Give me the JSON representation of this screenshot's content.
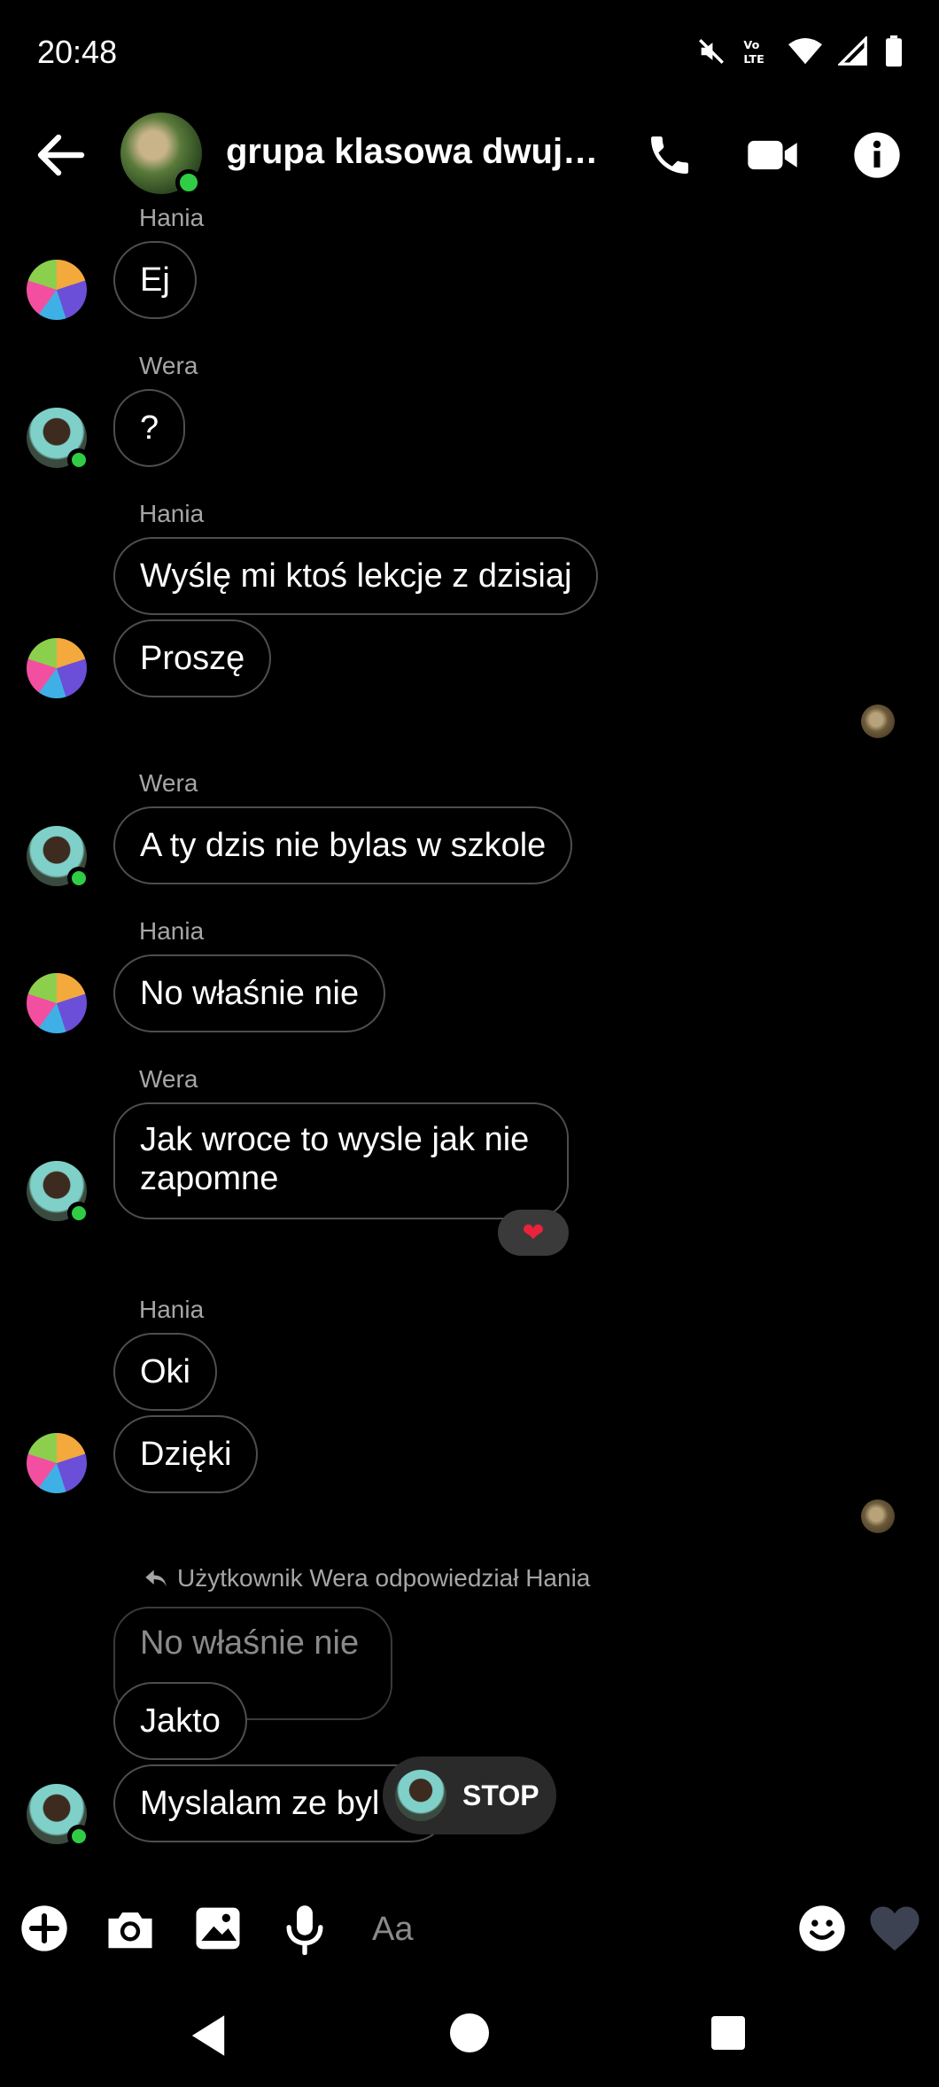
{
  "status_bar": {
    "time": "20:48"
  },
  "header": {
    "title": "grupa klasowa dwujęzy..."
  },
  "messages": [
    {
      "sender": "Hania",
      "text": "Ej"
    },
    {
      "sender": "Wera",
      "text": "?"
    },
    {
      "sender": "Hania",
      "text": "Wyślę mi ktoś lekcje z dzisiaj"
    },
    {
      "text": "Proszę"
    },
    {
      "sender": "Wera",
      "text": "A ty dzis nie bylas w szkole"
    },
    {
      "sender": "Hania",
      "text": "No właśnie nie"
    },
    {
      "sender": "Wera",
      "text": "Jak wroce to wysle jak nie zapomne",
      "reaction": "❤"
    },
    {
      "sender": "Hania",
      "text": "Oki"
    },
    {
      "text": "Dzięki"
    },
    {
      "text": "Jakto"
    },
    {
      "text": "Myslalam ze byl"
    }
  ],
  "reply": {
    "meta": "Użytkownik Wera odpowiedział Hania",
    "quoted": "No właśnie nie"
  },
  "stop_button": {
    "label": "STOP"
  },
  "composer": {
    "placeholder": "Aa"
  }
}
